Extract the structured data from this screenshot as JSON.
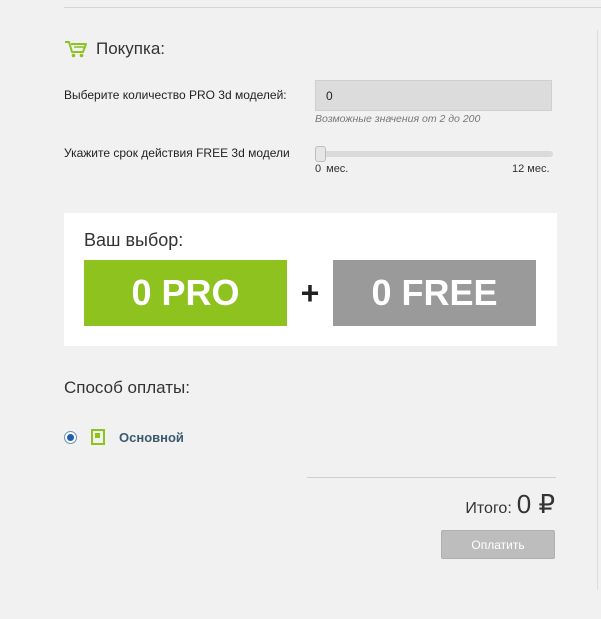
{
  "purchase": {
    "title": "Покупка:",
    "icon": "cart-icon",
    "pro_quantity": {
      "label": "Выберите количество PRO 3d моделей:",
      "value": "0",
      "hint": "Возможные значения от 2 до 200"
    },
    "free_term": {
      "label": "Укажите срок действия FREE 3d модели",
      "min_value": "0",
      "min_unit": "мес.",
      "max_label": "12 мес.",
      "current_fraction": 0
    }
  },
  "choice": {
    "title": "Ваш выбор:",
    "pro": "0 PRO",
    "plus": "+",
    "free": "0 FREE",
    "colors": {
      "pro": "#8dc21f",
      "free": "#9a9a9a"
    }
  },
  "payment": {
    "title": "Способ оплаты:",
    "options": [
      {
        "label": "Основной",
        "icon": "wallet-icon",
        "selected": true
      }
    ]
  },
  "total": {
    "label": "Итого:",
    "value": "0 ₽"
  },
  "pay_button": {
    "label": "Оплатить"
  }
}
